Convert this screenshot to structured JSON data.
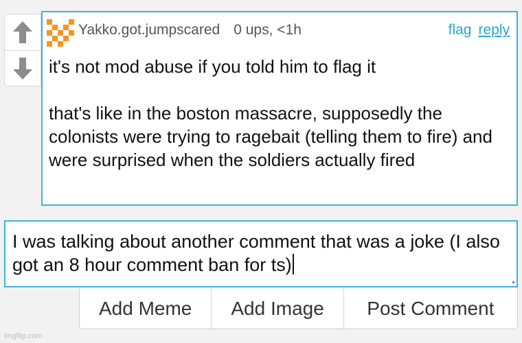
{
  "comment": {
    "username": "Yakko.got.jumpscared",
    "stats": "0 ups, <1h",
    "flag_label": "flag",
    "reply_label": "reply",
    "body": "it's not mod abuse if you told him to flag it\n\nthat's like in the boston massacre, supposedly the colonists were trying to ragebait (telling them to fire) and were surprised when the soldiers actually fired"
  },
  "reply_box": {
    "value": "I was talking about another comment that was a joke (I also got an 8 hour comment ban for ts)"
  },
  "buttons": {
    "add_meme": "Add Meme",
    "add_image": "Add Image",
    "post_comment": "Post Comment"
  },
  "watermark": "imgflip.com",
  "colors": {
    "accent": "#23a7d4",
    "border": "#3bb5d8",
    "avatar": "#f7941d"
  }
}
